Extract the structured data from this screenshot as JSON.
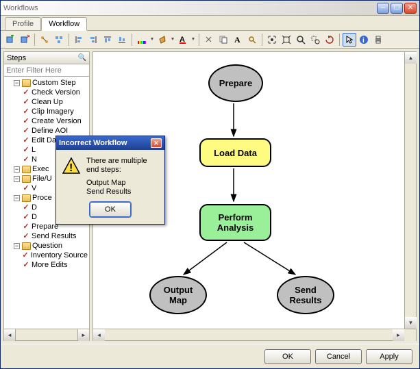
{
  "window": {
    "title": "Workflows"
  },
  "tabs": {
    "profile": "Profile",
    "workflow": "Workflow"
  },
  "sidebar": {
    "header": "Steps",
    "filter_placeholder": "Enter Filter Here",
    "items": [
      {
        "label": "Custom Step",
        "type": "folder",
        "expanded": true,
        "indent": 1
      },
      {
        "label": "Check Version",
        "type": "step",
        "indent": 2
      },
      {
        "label": "Clean Up",
        "type": "step",
        "indent": 2
      },
      {
        "label": "Clip Imagery",
        "type": "step",
        "indent": 2
      },
      {
        "label": "Create Version",
        "type": "step",
        "indent": 2
      },
      {
        "label": "Define AOI",
        "type": "step",
        "indent": 2
      },
      {
        "label": "Edit Data",
        "type": "step",
        "indent": 2
      },
      {
        "label": "L",
        "type": "step",
        "indent": 2,
        "truncated": true
      },
      {
        "label": "N",
        "type": "step",
        "indent": 2,
        "truncated": true
      },
      {
        "label": "Exec",
        "type": "folder",
        "expanded": true,
        "indent": 1,
        "truncated": true
      },
      {
        "label": "File/U",
        "type": "folder",
        "expanded": true,
        "indent": 1,
        "truncated": true
      },
      {
        "label": "V",
        "type": "step",
        "indent": 2,
        "truncated": true
      },
      {
        "label": "Proce",
        "type": "folder",
        "expanded": true,
        "indent": 1,
        "truncated": true
      },
      {
        "label": "D",
        "type": "step",
        "indent": 2,
        "truncated": true
      },
      {
        "label": "D",
        "type": "step",
        "indent": 2,
        "truncated": true
      },
      {
        "label": "Prepare",
        "type": "step",
        "indent": 2
      },
      {
        "label": "Send Results",
        "type": "step",
        "indent": 2
      },
      {
        "label": "Question",
        "type": "folder",
        "expanded": true,
        "indent": 1
      },
      {
        "label": "Inventory Source",
        "type": "step",
        "indent": 2
      },
      {
        "label": "More Edits",
        "type": "step",
        "indent": 2
      }
    ]
  },
  "diagram": {
    "nodes": {
      "prepare": {
        "label": "Prepare",
        "shape": "ellipse",
        "fill": "#c0c0c0"
      },
      "load": {
        "label": "Load Data",
        "shape": "rrect",
        "fill": "#fffb80"
      },
      "analyze": {
        "label": "Perform\nAnalysis",
        "shape": "rrect",
        "fill": "#99f099"
      },
      "output": {
        "label": "Output\nMap",
        "shape": "ellipse",
        "fill": "#c0c0c0"
      },
      "send": {
        "label": "Send\nResults",
        "shape": "ellipse",
        "fill": "#c0c0c0"
      }
    }
  },
  "error_dialog": {
    "title": "Incorrect Workflow",
    "message": "There are multiple end steps:",
    "details": "Output Map\nSend Results",
    "ok": "OK"
  },
  "footer": {
    "ok": "OK",
    "cancel": "Cancel",
    "apply": "Apply"
  },
  "colors": {
    "accent": "#3a6ad0"
  }
}
